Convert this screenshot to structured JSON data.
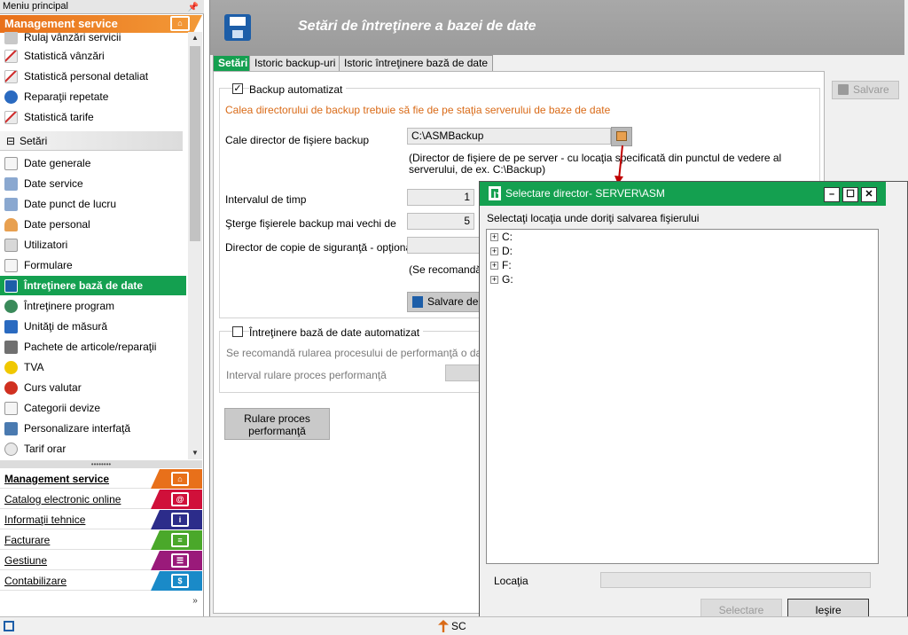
{
  "sidebar": {
    "header": "Meniu principal",
    "section_title": "Management service",
    "items_top": [
      {
        "label": "Rulaj vânzări servicii",
        "icon": "chart-icon"
      },
      {
        "label": "Statistică vânzări",
        "icon": "chart-icon"
      },
      {
        "label": "Statistică personal detaliat",
        "icon": "chart-icon"
      },
      {
        "label": "Reparaţii repetate",
        "icon": "repair-icon"
      },
      {
        "label": "Statistică tarife",
        "icon": "chart-icon"
      }
    ],
    "group_label": "Setări",
    "items_settings": [
      {
        "label": "Date generale",
        "icon": "document-icon"
      },
      {
        "label": "Date service",
        "icon": "building-icon"
      },
      {
        "label": "Date punct de lucru",
        "icon": "building-icon"
      },
      {
        "label": "Date personal",
        "icon": "person-icon"
      },
      {
        "label": "Utilizatori",
        "icon": "users-icon"
      },
      {
        "label": "Formulare",
        "icon": "form-icon"
      },
      {
        "label": "Întreţinere bază de date",
        "icon": "floppy-icon",
        "active": true
      },
      {
        "label": "Întreţinere program",
        "icon": "tool-icon"
      },
      {
        "label": "Unităţi de măsură",
        "icon": "ruler-icon"
      },
      {
        "label": "Pachete de articole/reparaţii",
        "icon": "package-icon"
      },
      {
        "label": "TVA",
        "icon": "tax-icon"
      },
      {
        "label": "Curs valutar",
        "icon": "currency-icon"
      },
      {
        "label": "Categorii devize",
        "icon": "category-icon"
      },
      {
        "label": "Personalizare interfaţă",
        "icon": "monitor-icon"
      },
      {
        "label": "Tarif orar",
        "icon": "clock-icon"
      }
    ],
    "nav_bands": [
      {
        "label": "Management service",
        "color": "#e8701a",
        "bold": true
      },
      {
        "label": "Catalog electronic online",
        "color": "#d0103a"
      },
      {
        "label": "Informaţii tehnice",
        "color": "#2c2c8a"
      },
      {
        "label": "Facturare",
        "color": "#4aa82a"
      },
      {
        "label": "Gestiune",
        "color": "#9a1a7a"
      },
      {
        "label": "Contabilizare",
        "color": "#1a8ac8"
      }
    ]
  },
  "main": {
    "title": "Setări de întreţinere a bazei de date",
    "tabs": [
      "Setări",
      "Istoric backup-uri",
      "Istoric întreţinere bază de date"
    ],
    "save_button": "Salvare",
    "backup": {
      "checkbox_label": "Backup automatizat",
      "checked": true,
      "warning": "Calea directorului de backup trebuie să fie de pe staţia serverului de baze de date",
      "path_label": "Cale director de fişiere backup",
      "path_value": "C:\\ASMBackup",
      "path_hint_1": "(Director de fişiere de pe server - cu locaţia specificată din punctul de vedere al",
      "path_hint_2": "serverului, de ex. C:\\Backup)",
      "interval_label": "Intervalul de timp",
      "interval_value": "1",
      "delete_label": "Şterge fişierele backup mai vechi de",
      "delete_value": "5",
      "copy_dir_label": "Director de copie de siguranţă - opţional",
      "copy_hint": "(Se recomandă",
      "save_backup_button": "Salvare de"
    },
    "maintenance": {
      "checkbox_label": "Întreţinere bază de date automatizat",
      "checked": false,
      "hint": "Se recomandă rularea procesului de performanţă o dată în",
      "interval_label": "Interval rulare proces performanţă",
      "run_button_line1": "Rulare proces",
      "run_button_line2": "performanţă"
    }
  },
  "dialog": {
    "title": "Selectare director-  SERVER\\ASM",
    "prompt": "Selectaţi locaţia unde doriţi salvarea fişierului",
    "drives": [
      "C:",
      "D:",
      "F:",
      "G:"
    ],
    "location_label": "Locaţia",
    "location_value": "",
    "select_button": "Selectare",
    "exit_button": "Ieşire"
  },
  "taskbar": {
    "item": "SC"
  }
}
